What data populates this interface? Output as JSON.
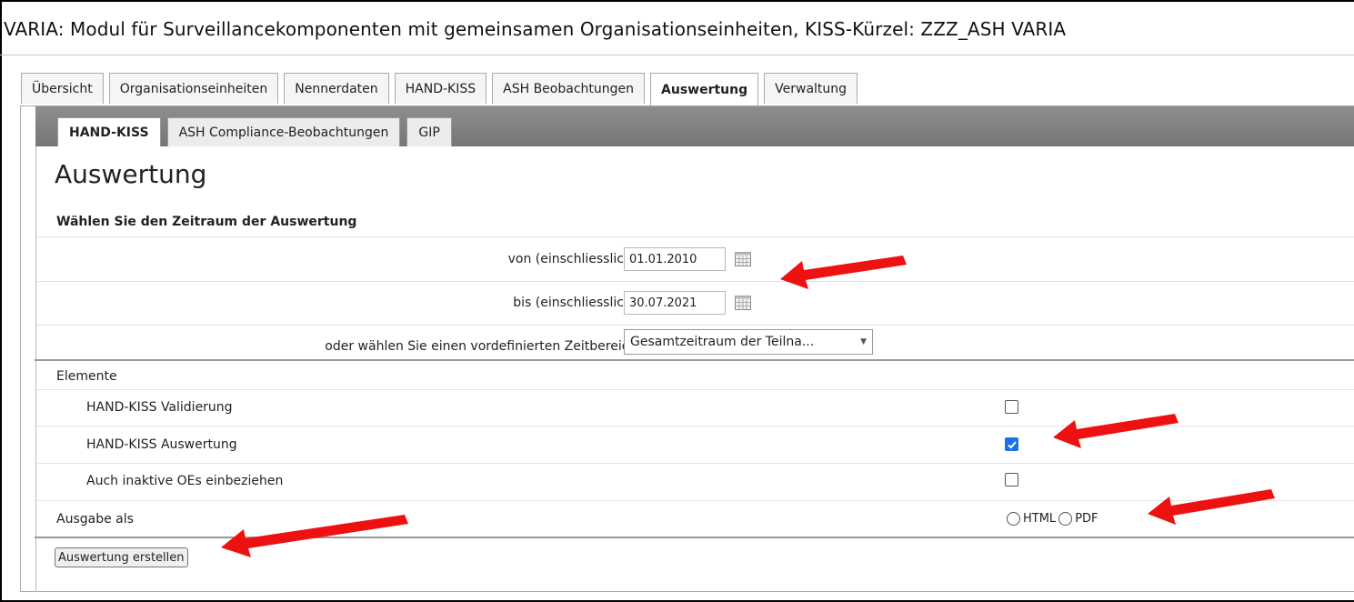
{
  "app_title": "VARIA: Modul für Surveillancekomponenten mit gemeinsamen Organisationseinheiten, KISS-Kürzel: ZZZ_ASH VARIA",
  "main_tabs": [
    {
      "label": "Übersicht"
    },
    {
      "label": "Organisationseinheiten"
    },
    {
      "label": "Nennerdaten"
    },
    {
      "label": "HAND-KISS"
    },
    {
      "label": "ASH Beobachtungen"
    },
    {
      "label": "Auswertung",
      "active": true
    },
    {
      "label": "Verwaltung"
    }
  ],
  "sub_tabs": [
    {
      "label": "HAND-KISS",
      "active": true
    },
    {
      "label": "ASH Compliance-Beobachtungen"
    },
    {
      "label": "GIP"
    }
  ],
  "page": {
    "title": "Auswertung",
    "section_heading": "Wählen Sie den Zeitraum der Auswertung",
    "from_label": "von (einschliesslich):",
    "from_value": "01.01.2010",
    "to_label": "bis (einschliesslich):",
    "to_value": "30.07.2021",
    "preset_label": "oder wählen Sie einen vordefinierten Zeitbereich:",
    "preset_value": "Gesamtzeitraum der Teilna...",
    "elements_heading": "Elemente",
    "elements": [
      {
        "label": "HAND-KISS Validierung",
        "checked": false
      },
      {
        "label": "HAND-KISS Auswertung",
        "checked": true
      },
      {
        "label": "Auch inaktive OEs einbeziehen",
        "checked": false
      }
    ],
    "output_label": "Ausgabe als",
    "output_options": [
      "HTML",
      "PDF"
    ],
    "submit_label": "Auswertung erstellen"
  },
  "icons": {
    "calendar": "calendar-icon",
    "dropdown": "chevron-down-icon",
    "checkmark": "check-icon"
  },
  "colors": {
    "annotation_arrow": "#ee1111",
    "checkbox_checked": "#1a73e8",
    "subtab_bar": "#808080"
  }
}
